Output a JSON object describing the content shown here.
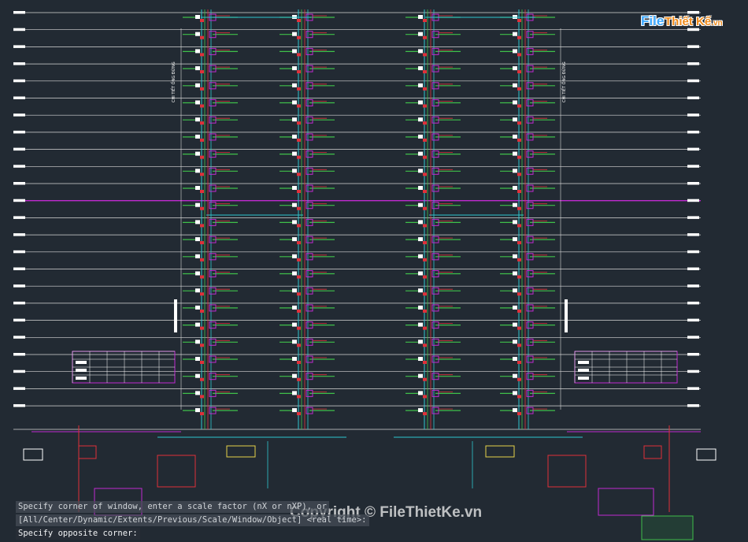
{
  "command_line": {
    "history": [
      "Specify corner of window, enter a scale factor (nX or nXP), or",
      "[All/Center/Dynamic/Extents/Previous/Scale/Window/Object] <real time>:"
    ],
    "prompt": "Specify opposite corner:"
  },
  "watermark": {
    "logo_file": "File",
    "logo_rest": "Thiết Kế",
    "logo_tld": ".vn",
    "copyright": "Copyright © FileThietKe.vn"
  },
  "drawing": {
    "background": "#222a33",
    "colors": {
      "floor_line": "#d8d8d8",
      "magenta": "#c02ad0",
      "cyan": "#2fc7cf",
      "red": "#e0303a",
      "green": "#3fbf4a",
      "yellow": "#e5d34a",
      "white": "#ffffff"
    },
    "vertical_notes": [
      "CHI TIẾT ỐNG ĐỨNG",
      "CHI TIẾT ỐNG ĐỨNG"
    ],
    "floor_count": 24,
    "riser_count": 4
  }
}
